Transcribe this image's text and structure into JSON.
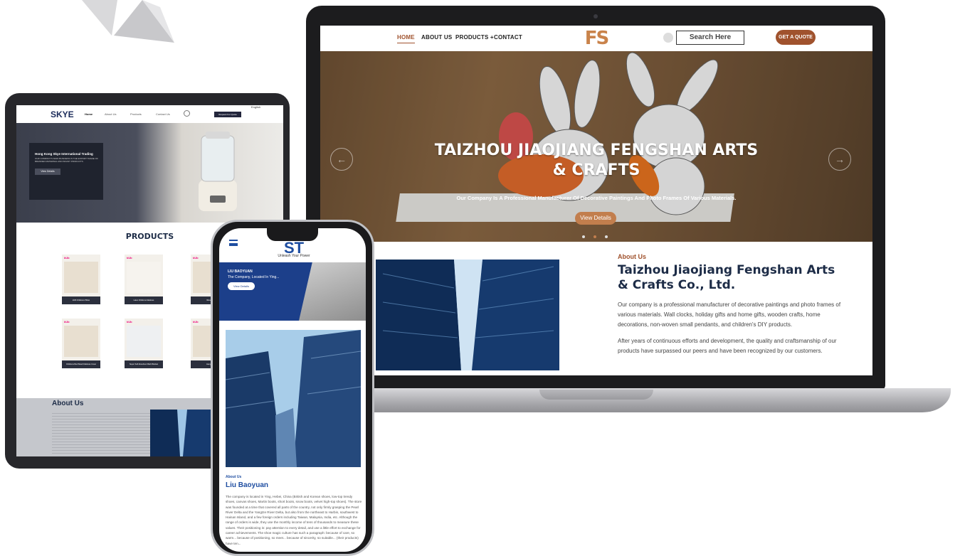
{
  "laptop": {
    "nav": {
      "home": "HOME",
      "about": "ABOUT US",
      "products": "PRODUCTS +",
      "contact": "CONTACT",
      "logo": "FS",
      "search_placeholder": "Search Here",
      "quote": "GET A QUOTE"
    },
    "hero": {
      "title": "TAIZHOU JIAOJIANG FENGSHAN ARTS & CRAFTS",
      "subtitle": "Our Company Is A Professional Manufacturer Of Decorative Paintings And Photo Frames Of Various Materials.",
      "button": "View Details",
      "prev": "←",
      "next": "→"
    },
    "about": {
      "tag": "About Us",
      "title": "Taizhou Jiaojiang Fengshan Arts & Crafts Co., Ltd.",
      "p1": "Our company is a professional manufacturer of decorative paintings and photo frames of various materials. Wall clocks, holiday gifts and home gifts, wooden crafts, home decorations, non-woven small pendants, and children's DIY products.",
      "p2": "After years of continuous efforts and development, the quality and craftsmanship of our products have surpassed our peers and have been recognized by our customers."
    }
  },
  "tablet": {
    "nav": {
      "logo": "SKYE",
      "home": "Home",
      "about": "About Us",
      "products": "Products",
      "contact": "Contact Us",
      "request": "Request For Quote",
      "lang": "English"
    },
    "hero": {
      "title": "Hong Kong Skye International Trading",
      "text": "OUR COMPANY'S MAIN BUSINESS IS THE EXPORT TRADE OF BRANDED MATERNAL AND INFANT PRODUCTS.",
      "button": "View Details"
    },
    "products_title": "PRODUCTS",
    "products": [
      {
        "brand": "kUb",
        "name": "kUB Childrens Pillow"
      },
      {
        "brand": "kUb",
        "name": "Latex Childrens Mattress"
      },
      {
        "brand": "kUb",
        "name": "Wooden"
      },
      {
        "brand": "kUb",
        "name": "Childrens Bed Board Mattress Cover"
      },
      {
        "brand": "kUb",
        "name": "Super Soft Absorbent Bath Blanket"
      },
      {
        "brand": "kUb",
        "name": "Hanging"
      }
    ],
    "about_title": "About Us"
  },
  "phone": {
    "logo": "ST",
    "tagline": "Unleash Your Power",
    "hero": {
      "t1": "LIU BAOYUAN",
      "t2": "The Company, Located In Ying...",
      "button": "View Details"
    },
    "about_tag": "About Us",
    "about_title": "Liu Baoyuan",
    "about_text": "The company is located in Ying, Hebei, China (British and Korean shoes, low-top trendy shoes, canvas shoes, Martin boots, short boots, snow boots, velvet high-top shoes). The store was founded at a time that covered all parts of the country, not only firmly grasping the Pearl River Delta and the Yangtze River Delta, but also from the northeast to Harbin, southwest to Hainan Island, and a few foreign orders including Taiwan, Malaysia, India, etc. Although the range of orders is wide, they use the monthly income of tens of thousands to measure these values. Their positioning is: pay attention to every detail, and use a little effort to exchange for career achievements. The shoe magic culture has such a paragraph: because of care, so warm... because of positioning, so meet... because of sincerity, so suitable... (their products) have ten..."
  },
  "colors": {
    "accent": "#a0522d",
    "navy": "#1d2c47",
    "phone_blue": "#1f4ea1"
  }
}
